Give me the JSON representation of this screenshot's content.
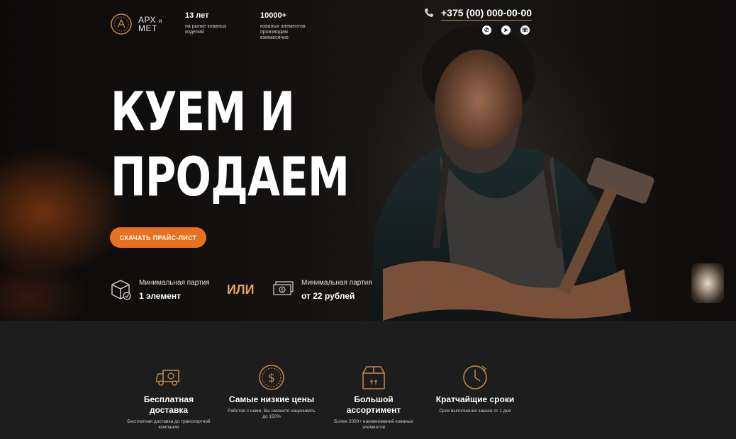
{
  "header": {
    "logo_top": "АРХ",
    "logo_small": "и",
    "logo_bottom": "МЕТ",
    "stats": [
      {
        "num": "13 лет",
        "desc": "на рынке кованых изделий"
      },
      {
        "num": "10000+",
        "desc": "кованых элементов производим ежемесячно"
      }
    ],
    "phone": "+375 (00) 000-00-00",
    "socials": [
      "whatsapp-icon",
      "telegram-icon",
      "viber-icon"
    ]
  },
  "hero": {
    "headline_line1": "КУЕМ И",
    "headline_line2": "ПРОДАЕМ",
    "cta_label": "СКАЧАТЬ ПРАЙС-ЛИСТ",
    "min_batch_1_label": "Минимальная партия",
    "min_batch_1_value": "1 элемент",
    "or_label": "ИЛИ",
    "min_batch_2_label": "Минимальная партия",
    "min_batch_2_value": "от 22 рублей"
  },
  "features": [
    {
      "title": "Бесплатная доставка",
      "desc": "Бесплатная доставка до транспортной компании",
      "icon": "delivery-truck-icon"
    },
    {
      "title": "Самые низкие цены",
      "desc": "Работая с нами, Вы сможете наценивать до 150%",
      "icon": "dollar-coin-icon"
    },
    {
      "title": "Большой ассортимент",
      "desc": "Более 2000+ наименований кованых элементов",
      "icon": "box-icon"
    },
    {
      "title": "Кратчайщие сроки",
      "desc": "Срок выполнения заказа от 1 дня",
      "icon": "clock-icon"
    }
  ],
  "colors": {
    "accent": "#e8711d",
    "gold": "#c78a4a",
    "dark": "#1d1d1d"
  }
}
